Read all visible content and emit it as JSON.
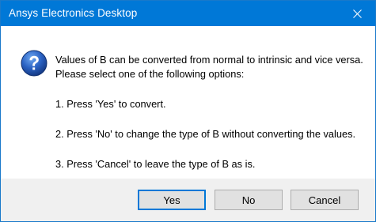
{
  "window": {
    "title": "Ansys Electronics Desktop",
    "accent_color": "#0078d7"
  },
  "dialog": {
    "icon": "question-icon",
    "message_lines": [
      "Values of B can be converted from normal to intrinsic and vice versa.",
      "Please select one of the following options:",
      "1. Press 'Yes' to convert.",
      "2. Press 'No' to change the type of B without converting the values.",
      "3. Press 'Cancel' to leave the type of B as is."
    ]
  },
  "buttons": {
    "yes": "Yes",
    "no": "No",
    "cancel": "Cancel"
  }
}
